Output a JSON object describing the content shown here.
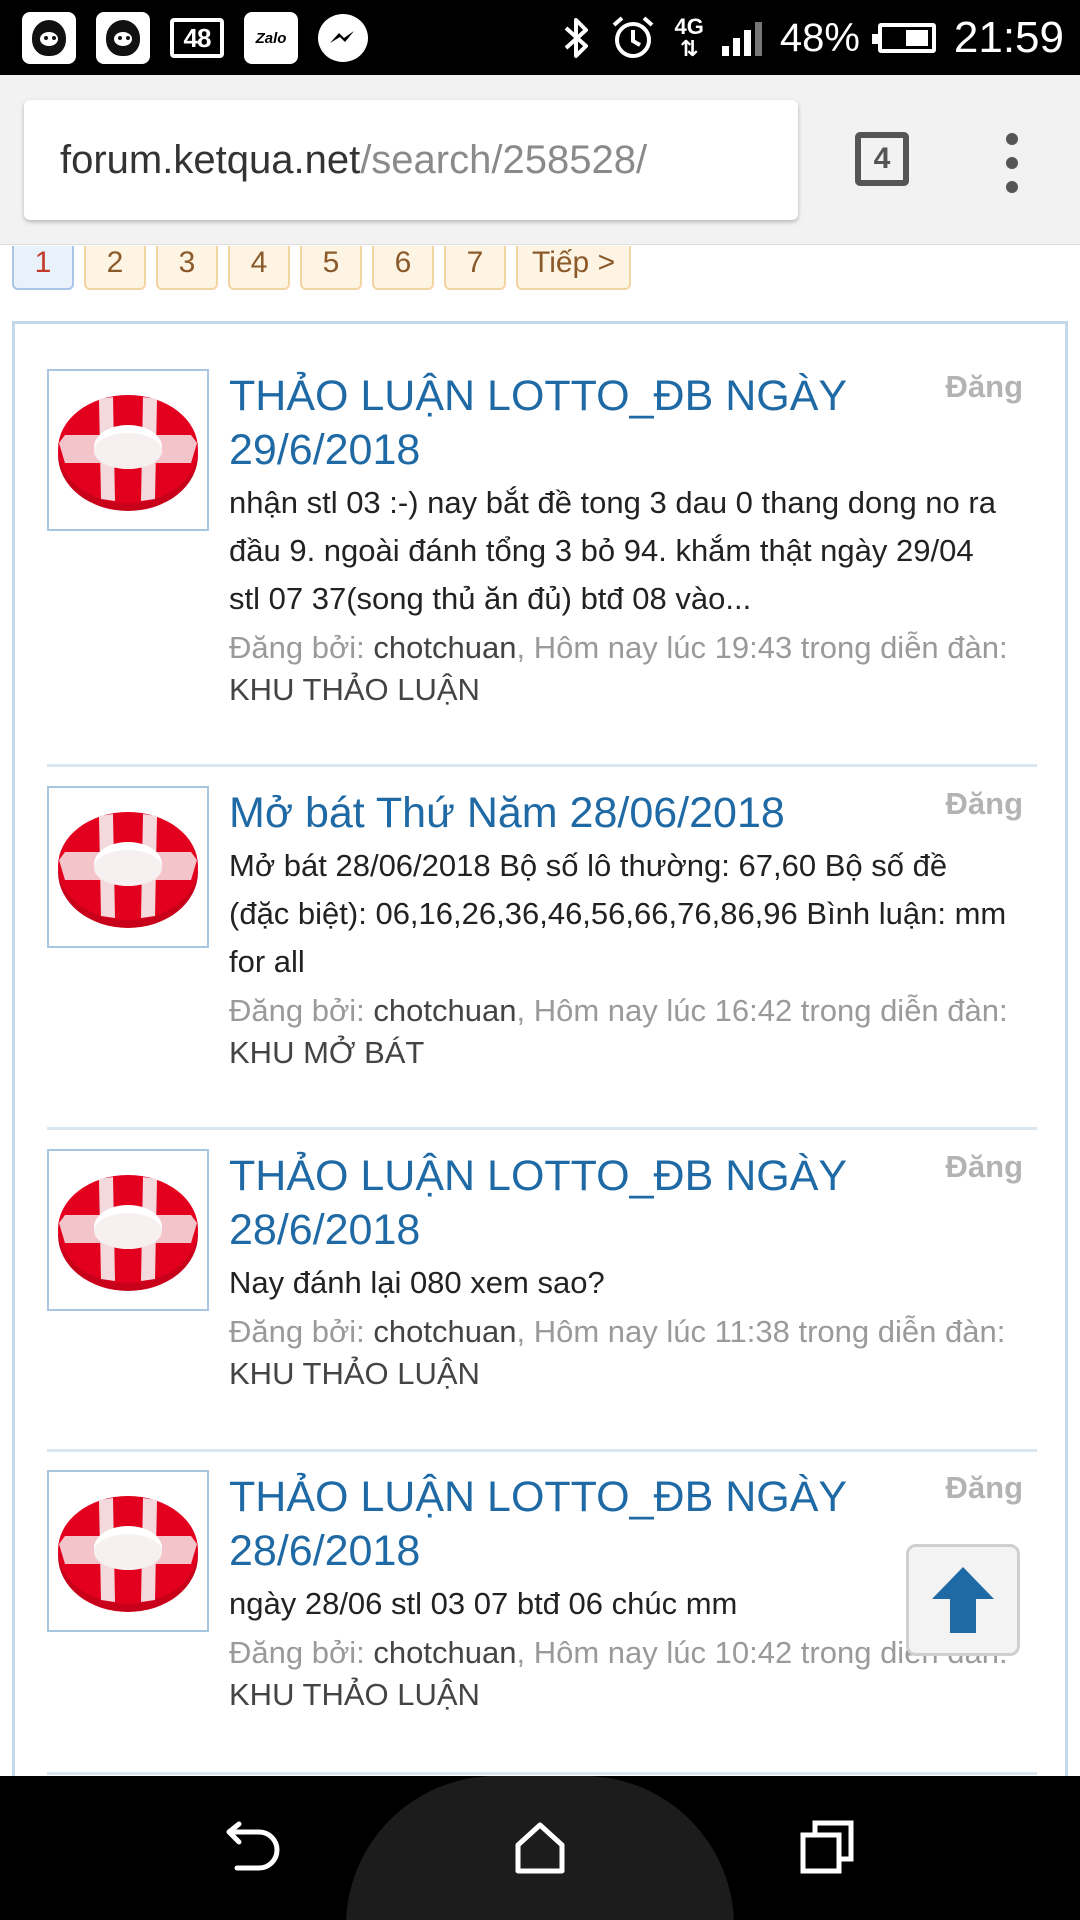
{
  "status_bar": {
    "notification_badge": "48",
    "zalo_label": "Zalo",
    "network": "4G",
    "battery": "48%",
    "time": "21:59",
    "icons": [
      "app-icon",
      "app-icon",
      "badge-icon",
      "zalo-icon",
      "messenger-icon",
      "bluetooth-icon",
      "alarm-icon",
      "4g-icon",
      "signal-icon",
      "battery-icon"
    ]
  },
  "browser": {
    "url_host": "forum.ketqua.net",
    "url_path": "/search/258528/",
    "tab_count": "4"
  },
  "pagination": {
    "pages": [
      "1",
      "2",
      "3",
      "4",
      "5",
      "6",
      "7"
    ],
    "current": "1",
    "next_label": "Tiếp >"
  },
  "results": [
    {
      "title": "THẢO LUẬN LOTTO_ĐB NGÀY 29/6/2018",
      "date_label": "Đăng",
      "snippet": "nhận stl 03 :-) nay bắt đề tong 3 dau 0 thang dong no ra đầu 9. ngoài đánh tổng 3 bỏ 94. khắm thật ngày 29/04 stl 07 37(song thủ ăn đủ) btđ 08 vào...",
      "posted_by_label": "Đăng bởi:",
      "author": "chotchuan",
      "time_text": ", Hôm nay lúc 19:43 trong diễn đàn:",
      "forum": "KHU THẢO LUẬN"
    },
    {
      "title": "Mở bát Thứ Năm 28/06/2018",
      "date_label": "Đăng",
      "snippet": "Mở bát 28/06/2018 Bộ số lô thường: 67,60 Bộ số đề (đặc biệt): 06,16,26,36,46,56,66,76,86,96 Bình luận: mm for all",
      "posted_by_label": "Đăng bởi:",
      "author": "chotchuan",
      "time_text": ", Hôm nay lúc 16:42 trong diễn đàn:",
      "forum": "KHU MỞ BÁT"
    },
    {
      "title": "THẢO LUẬN LOTTO_ĐB NGÀY 28/6/2018",
      "date_label": "Đăng",
      "snippet": "Nay đánh lại 080 xem sao?",
      "posted_by_label": "Đăng bởi:",
      "author": "chotchuan",
      "time_text": ", Hôm nay lúc 11:38 trong diễn đàn:",
      "forum": "KHU THẢO LUẬN"
    },
    {
      "title": "THẢO LUẬN LOTTO_ĐB NGÀY 28/6/2018",
      "date_label": "Đăng",
      "snippet": "ngày 28/06 stl 03 07 btđ 06 chúc mm",
      "posted_by_label": "Đăng bởi:",
      "author": "chotchuan",
      "time_text": ", Hôm nay lúc 10:42 trong diễn đàn:",
      "forum": "KHU THẢO LUẬN"
    }
  ],
  "colors": {
    "title_link": "#1f6aa5",
    "meta_gray": "#9a9a9a",
    "page_current_text": "#c0392b",
    "page_text": "#8b5a2b",
    "back_to_top_arrow": "#1f6aa5"
  },
  "navigation": {
    "icons": [
      "back-icon",
      "home-icon",
      "recents-icon"
    ]
  }
}
